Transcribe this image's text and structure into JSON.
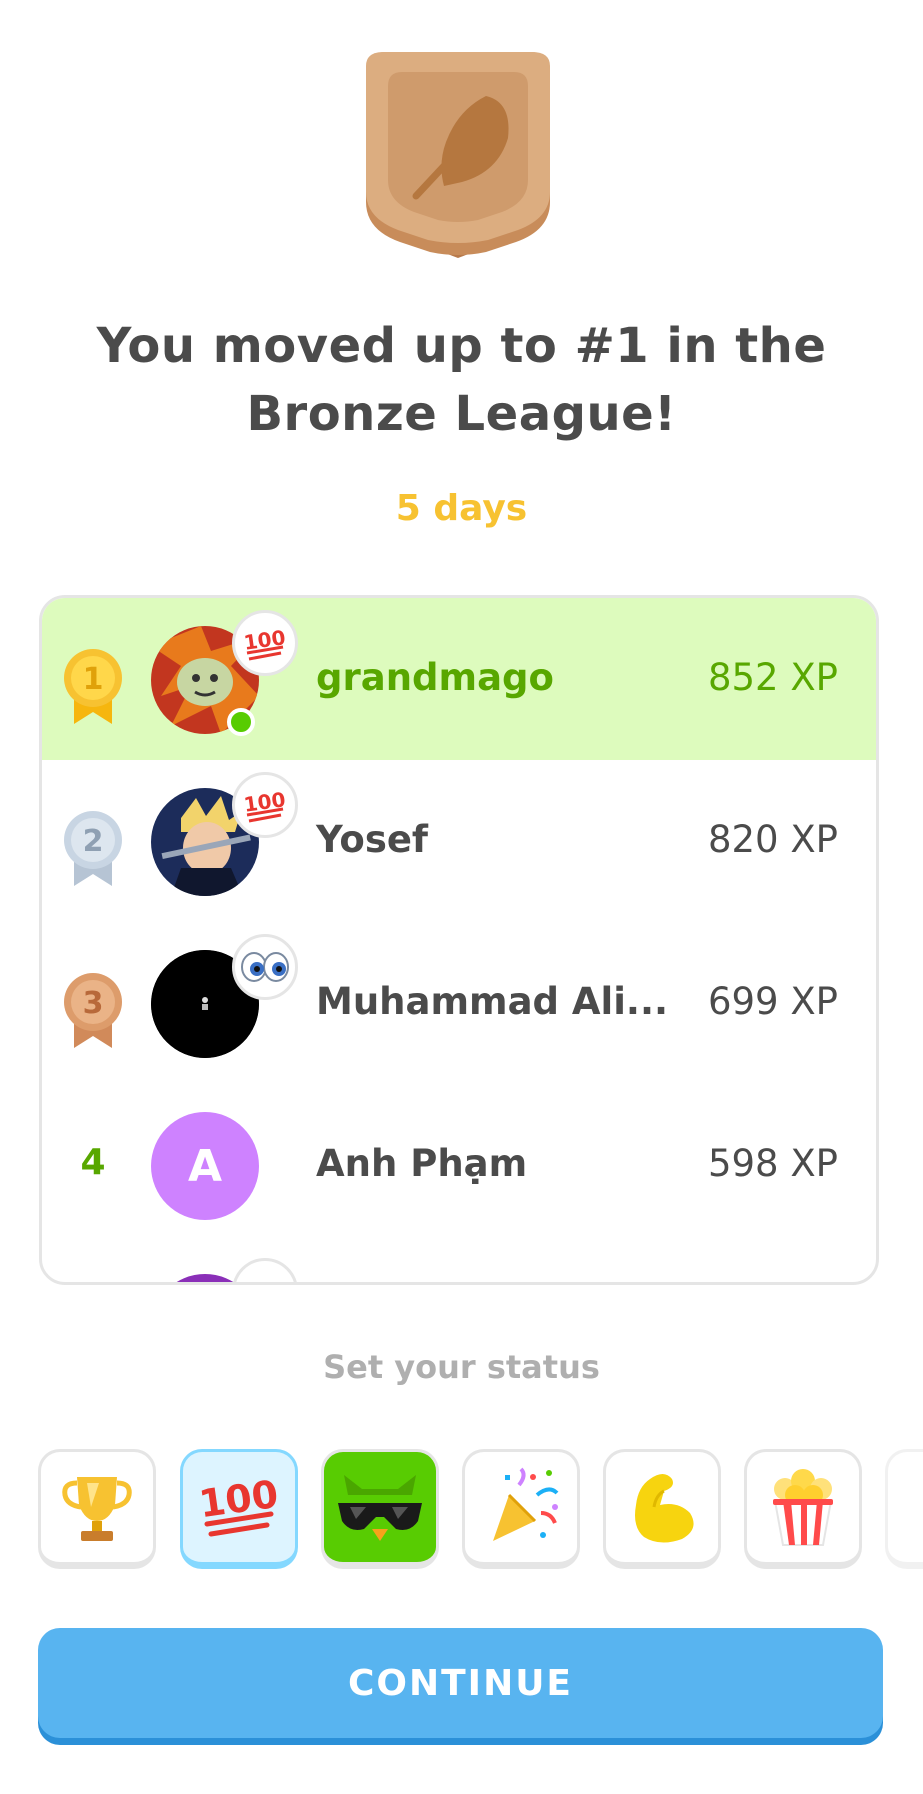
{
  "league": {
    "badge_icon": "feather-league-badge-icon",
    "headline": "You moved up to #1 in the Bronze League!",
    "time_left": "5 days"
  },
  "leaderboard": [
    {
      "rank": "1",
      "rank_icon": "gold-medal-icon",
      "name": "grandmago",
      "xp": "852 XP",
      "status_emoji": "100",
      "online": true,
      "is_me": true
    },
    {
      "rank": "2",
      "rank_icon": "silver-medal-icon",
      "name": "Yosef",
      "xp": "820 XP",
      "status_emoji": "100",
      "online": false,
      "is_me": false
    },
    {
      "rank": "3",
      "rank_icon": "bronze-medal-icon",
      "name": "Muhammad Ali...",
      "xp": "699 XP",
      "status_emoji": "eyes",
      "online": false,
      "is_me": false
    },
    {
      "rank": "4",
      "name": "Anh Phạm",
      "avatar_letter": "A",
      "xp": "598 XP",
      "online": false,
      "is_me": false
    }
  ],
  "status": {
    "label": "Set your status",
    "options": [
      "trophy-icon",
      "hundred-points-icon",
      "cool-owl-icon",
      "party-popper-icon",
      "flexed-biceps-icon",
      "popcorn-icon"
    ],
    "selected": "hundred-points-icon"
  },
  "continue_label": "CONTINUE",
  "colors": {
    "accent": "#58b4f0",
    "highlight": "#ddfbbd",
    "green": "#58a700",
    "gold": "#f7c231"
  }
}
